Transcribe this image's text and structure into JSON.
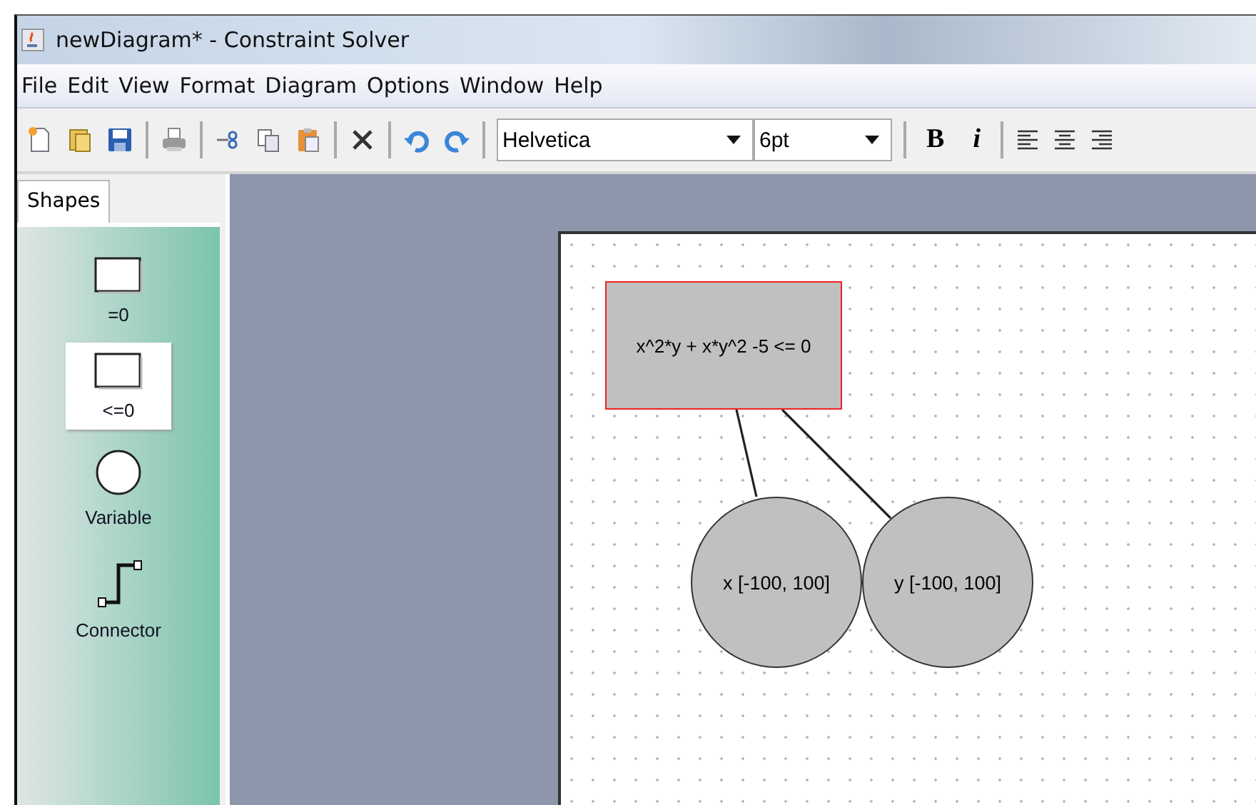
{
  "window": {
    "title": "newDiagram* - Constraint Solver"
  },
  "menu": [
    "File",
    "Edit",
    "View",
    "Format",
    "Diagram",
    "Options",
    "Window",
    "Help"
  ],
  "toolbar": {
    "font": "Helvetica",
    "size": "6pt",
    "bold": "B",
    "italic": "i"
  },
  "palette": {
    "tab": "Shapes",
    "items": [
      {
        "kind": "rect",
        "label": "=0",
        "selected": false
      },
      {
        "kind": "rect",
        "label": "<=0",
        "selected": true
      },
      {
        "kind": "circle",
        "label": "Variable",
        "selected": false
      },
      {
        "kind": "connector",
        "label": "Connector",
        "selected": false
      }
    ]
  },
  "diagram": {
    "constraints": [
      {
        "label": "x^2*y + x*y^2 -5 <= 0",
        "selected": true
      }
    ],
    "variables": [
      {
        "label": "x [-100, 100]",
        "selected": false
      },
      {
        "label": "y [-100, 100]",
        "selected": false
      }
    ]
  }
}
